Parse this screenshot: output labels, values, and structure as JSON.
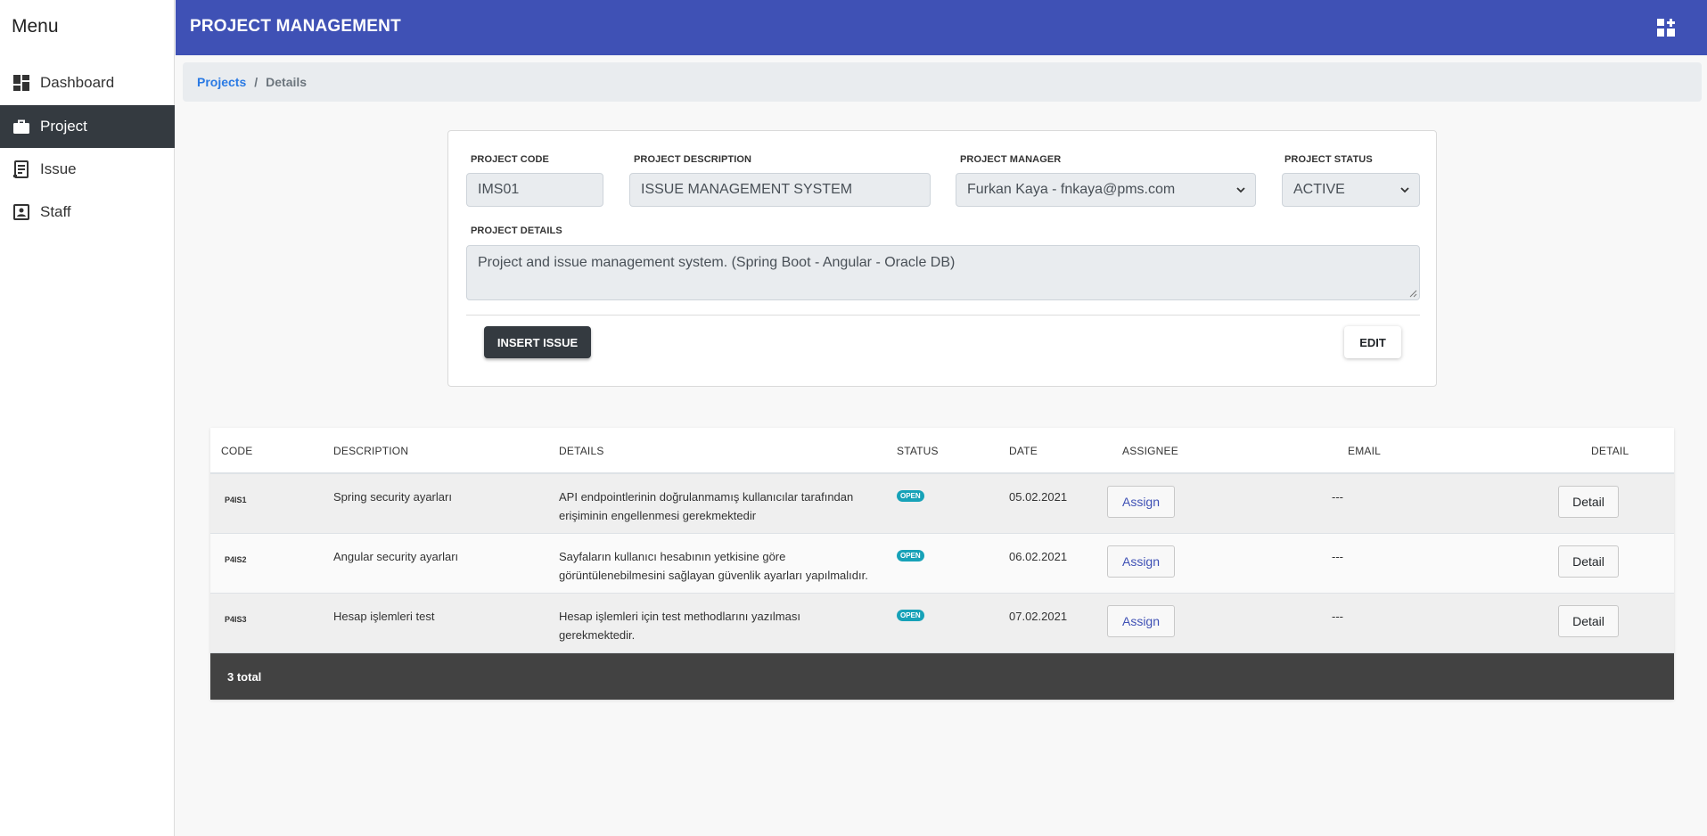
{
  "sidebar": {
    "title": "Menu",
    "items": [
      {
        "label": "Dashboard",
        "icon": "dashboard-icon"
      },
      {
        "label": "Project",
        "icon": "briefcase-icon",
        "active": true
      },
      {
        "label": "Issue",
        "icon": "issue-icon"
      },
      {
        "label": "Staff",
        "icon": "contact-icon"
      }
    ]
  },
  "header": {
    "title": "PROJECT MANAGEMENT",
    "icon": "dashboard-customize-icon",
    "color": "#3f51b5"
  },
  "breadcrumb": {
    "parent": "Projects",
    "separator": "/",
    "current": "Details"
  },
  "project": {
    "code_label": "PROJECT CODE",
    "code_value": "IMS01",
    "description_label": "PROJECT DESCRIPTION",
    "description_value": "ISSUE MANAGEMENT SYSTEM",
    "manager_label": "PROJECT MANAGER",
    "manager_value": "Furkan Kaya - fnkaya@pms.com",
    "status_label": "PROJECT STATUS",
    "status_value": "ACTIVE",
    "details_label": "PROJECT DETAILS",
    "details_value": "Project and issue management system. (Spring Boot - Angular - Oracle DB)",
    "insert_button": "INSERT ISSUE",
    "edit_button": "EDIT"
  },
  "table": {
    "columns": [
      "CODE",
      "DESCRIPTION",
      "DETAILS",
      "STATUS",
      "DATE",
      "ASSIGNEE",
      "EMAIL",
      "DETAIL"
    ],
    "rows": [
      {
        "code": "P4IS1",
        "description": "Spring security ayarları",
        "details_line1": "API endpointlerinin doğrulanmamış kullanıcılar tarafından",
        "details_line2": "erişiminin engellenmesi gerekmektedir",
        "status": "OPEN",
        "date": "05.02.2021",
        "assign_label": "Assign",
        "email": "---",
        "detail_label": "Detail"
      },
      {
        "code": "P4IS2",
        "description": "Angular security ayarları",
        "details_line1": "Sayfaların kullanıcı hesabının yetkisine göre",
        "details_line2": "görüntülenebilmesini sağlayan güvenlik ayarları yapılmalıdır.",
        "status": "OPEN",
        "date": "06.02.2021",
        "assign_label": "Assign",
        "email": "---",
        "detail_label": "Detail"
      },
      {
        "code": "P4IS3",
        "description": "Hesap işlemleri test",
        "details_line1": "Hesap işlemleri için test methodlarını yazılması",
        "details_line2": "gerekmektedir.",
        "status": "OPEN",
        "date": "07.02.2021",
        "assign_label": "Assign",
        "email": "---",
        "detail_label": "Detail"
      }
    ],
    "footer": "3 total",
    "status_color": "#17a2b8"
  }
}
